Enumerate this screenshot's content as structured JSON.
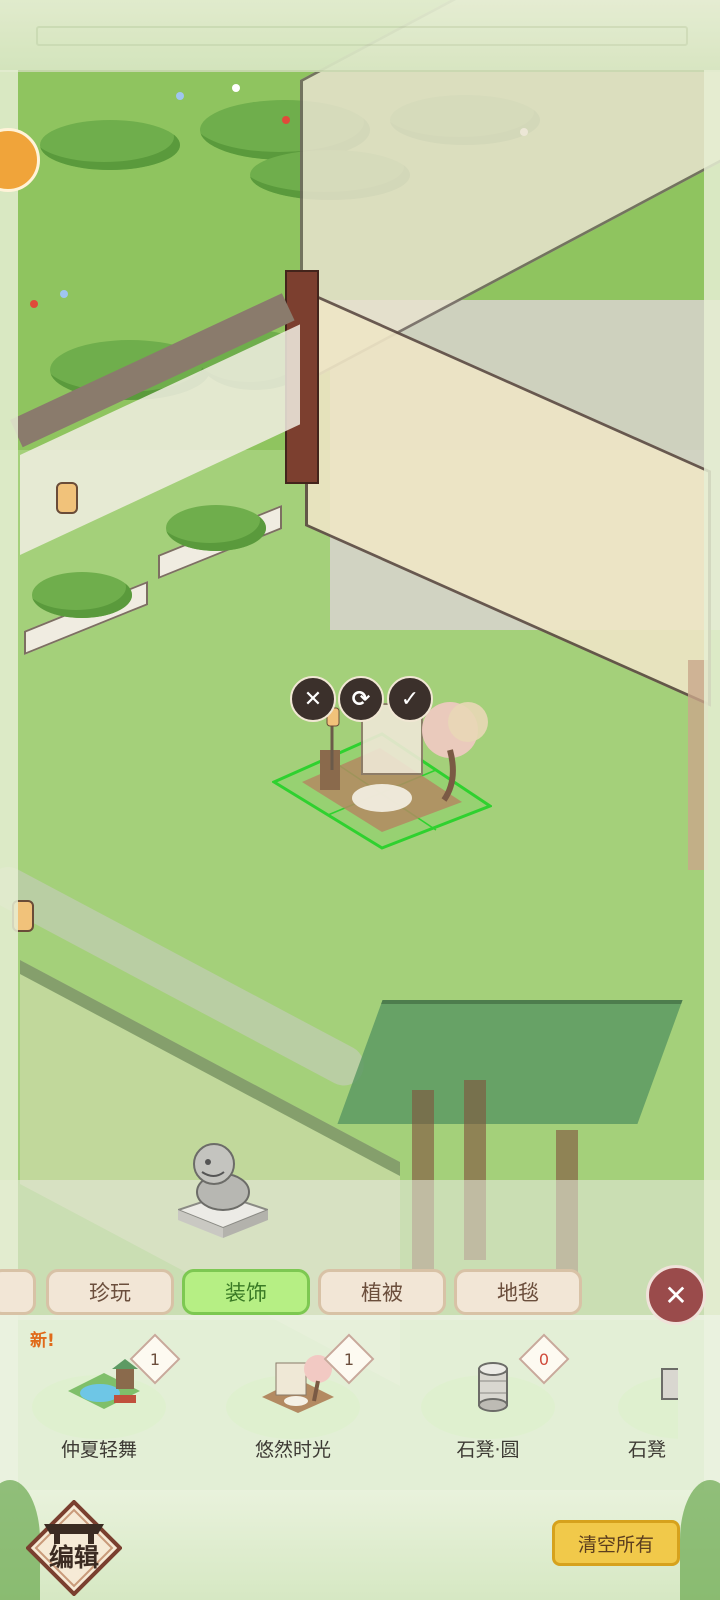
{
  "tabs": [
    {
      "label": "珍玩",
      "active": false
    },
    {
      "label": "装饰",
      "active": true
    },
    {
      "label": "植被",
      "active": false
    },
    {
      "label": "地毯",
      "active": false
    }
  ],
  "placement_actions": {
    "cancel_icon": "✕",
    "rotate_icon": "⟳",
    "confirm_icon": "✓"
  },
  "new_badge": "新!",
  "items": [
    {
      "name": "仲夏轻舞",
      "count": "1",
      "icon": "pond-pavilion-icon"
    },
    {
      "name": "悠然时光",
      "count": "1",
      "icon": "garden-swing-icon"
    },
    {
      "name": "石凳·圆",
      "count": "0",
      "icon": "round-stone-stool-icon"
    },
    {
      "name": "石凳",
      "count": "",
      "icon": "stone-stool-icon"
    }
  ],
  "close_panel_icon": "✕",
  "edit_button_label": "编辑",
  "clear_all_label": "清空所有",
  "colors": {
    "active_tab": "#b6ef84",
    "tab": "#f2e6d6",
    "grass": "#a4d07a",
    "clear_button": "#f1c94a",
    "placement_grid": "#2fd12f"
  }
}
